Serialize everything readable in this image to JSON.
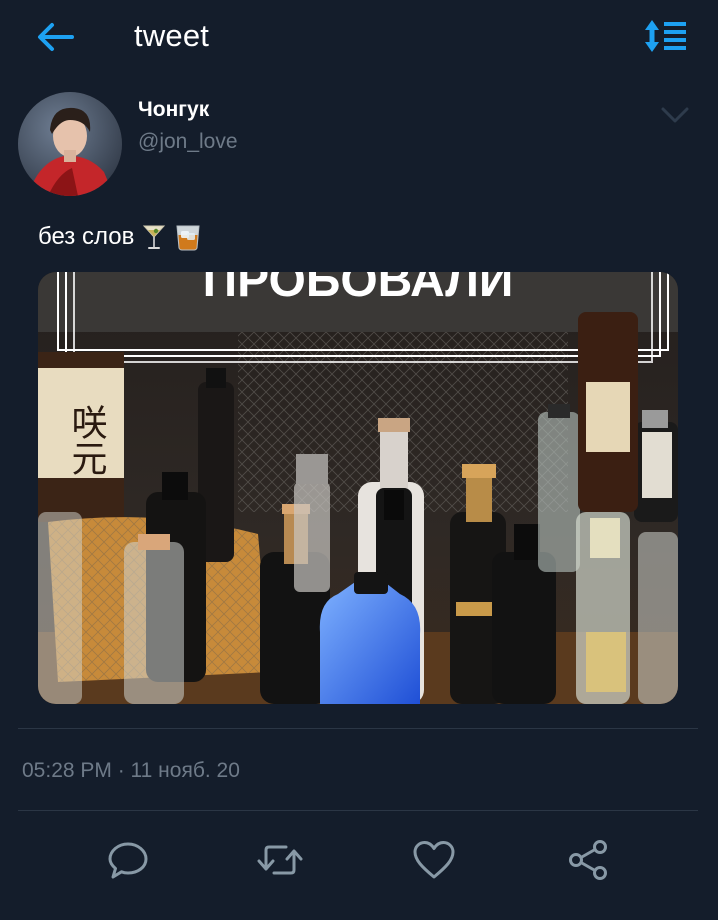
{
  "header": {
    "title": "tweet",
    "back_icon": "arrow-left-icon",
    "sort_icon": "sort-lines-icon",
    "accent_color": "#1da1f2"
  },
  "author": {
    "display_name": "Чонгук",
    "handle": "@jon_love"
  },
  "tweet": {
    "text": "без слов",
    "emojis": [
      "cocktail-glass-icon",
      "tumbler-glass-icon"
    ],
    "media": {
      "kind": "photo",
      "overlay_text": "ПРОБОВАЛИ",
      "label_text": "咲元"
    }
  },
  "meta": {
    "timestamp": "05:28 PM · 11 нояб. 20"
  },
  "actions": [
    {
      "name": "reply",
      "icon": "comment-icon"
    },
    {
      "name": "retweet",
      "icon": "retweet-icon"
    },
    {
      "name": "like",
      "icon": "heart-icon"
    },
    {
      "name": "share",
      "icon": "share-icon"
    }
  ],
  "colors": {
    "background": "#141d2b",
    "secondary_text": "#6e7a88",
    "divider": "#2b3645",
    "icon": "#8899a6"
  }
}
